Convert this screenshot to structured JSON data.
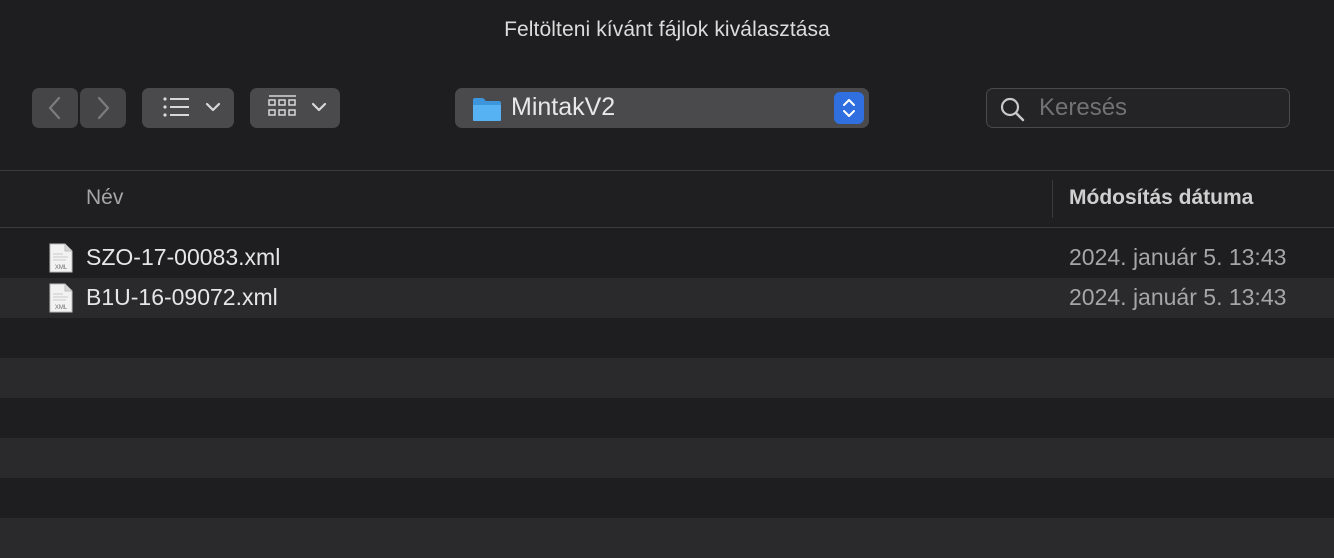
{
  "window": {
    "title": "Feltölteni kívánt fájlok kiválasztása"
  },
  "toolbar": {
    "back_icon": "chevron-left-icon",
    "forward_icon": "chevron-right-icon",
    "view_list_icon": "list-view-icon",
    "view_grid_icon": "grid-view-icon",
    "location": "MintakV2",
    "location_icon": "folder-icon",
    "search_placeholder": "Keresés"
  },
  "columns": {
    "name": "Név",
    "date": "Módosítás dátuma"
  },
  "files": [
    {
      "name": "SZO-17-00083.xml",
      "date": "2024. január 5. 13:43",
      "icon": "xml-file-icon",
      "icon_label": "XML"
    },
    {
      "name": "B1U-16-09072.xml",
      "date": "2024. január 5. 13:43",
      "icon": "xml-file-icon",
      "icon_label": "XML"
    }
  ],
  "colors": {
    "background": "#1e1e20",
    "alt_row": "#2a2a2c",
    "accent": "#2f6fe0",
    "folder": "#4aa8f0"
  }
}
